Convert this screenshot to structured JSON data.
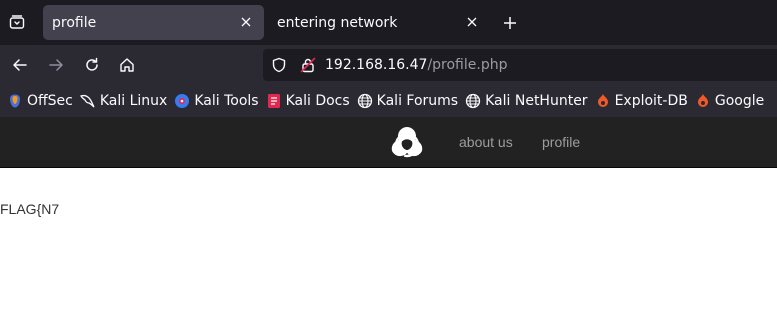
{
  "tabs": [
    {
      "title": "profile",
      "active": true
    },
    {
      "title": "entering network",
      "active": false
    }
  ],
  "url": {
    "host": "192.168.16.47",
    "path": "/profile.php"
  },
  "bookmarks": [
    {
      "label": "OffSec",
      "icon": "offsec-icon"
    },
    {
      "label": "Kali Linux",
      "icon": "kali-dragon-icon"
    },
    {
      "label": "Kali Tools",
      "icon": "kali-tools-icon"
    },
    {
      "label": "Kali Docs",
      "icon": "kali-docs-icon"
    },
    {
      "label": "Kali Forums",
      "icon": "globe-icon"
    },
    {
      "label": "Kali NetHunter",
      "icon": "globe-icon"
    },
    {
      "label": "Exploit-DB",
      "icon": "exploit-db-icon"
    },
    {
      "label": "Google",
      "icon": "google-hacking-icon"
    }
  ],
  "site": {
    "logo": "biohazard-icon",
    "nav": {
      "about": "about us",
      "profile": "profile"
    },
    "content_text": "FLAG{N7"
  },
  "colors": {
    "browser_chrome": "#2b2a33",
    "tabstrip": "#1c1b22",
    "site_navbar": "#222222",
    "site_link": "#9d9d9d"
  }
}
